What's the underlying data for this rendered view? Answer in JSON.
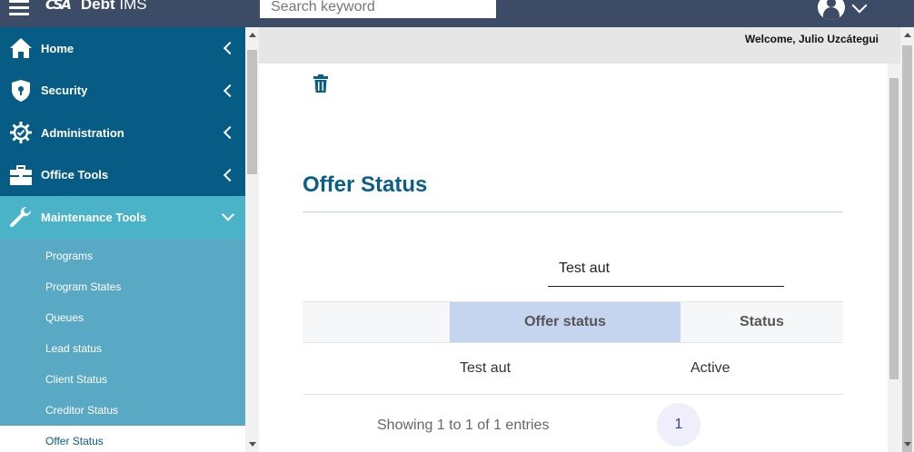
{
  "header": {
    "logo_mark": "CSA",
    "app_name_bold": "Debt",
    "app_name_rest": " IMS",
    "search_placeholder": "Search keyword",
    "icons": [
      "hamburger-icon",
      "user-avatar-icon",
      "chevron-down-icon"
    ]
  },
  "sidebar": {
    "items": [
      {
        "label": "Home",
        "icon": "home-icon"
      },
      {
        "label": "Security",
        "icon": "shield-icon"
      },
      {
        "label": "Administration",
        "icon": "gear-icon"
      },
      {
        "label": "Office Tools",
        "icon": "briefcase-icon"
      },
      {
        "label": "Maintenance Tools",
        "icon": "wrench-icon",
        "expanded": true
      }
    ],
    "sub_items": [
      {
        "label": "Programs"
      },
      {
        "label": "Program States"
      },
      {
        "label": "Queues"
      },
      {
        "label": "Lead status"
      },
      {
        "label": "Client Status"
      },
      {
        "label": "Creditor Status"
      },
      {
        "label": "Offer Status",
        "active": true
      }
    ]
  },
  "main": {
    "welcome": "Welcome, Julio Uzcátegui",
    "page_title": "Offer Status",
    "filter_value": "Test aut",
    "table": {
      "columns": [
        "",
        "Offer status",
        "Status"
      ],
      "rows": [
        {
          "offer_status": "Test aut",
          "status": "Active"
        }
      ]
    },
    "showing": "Showing 1 to 1 of 1 entries",
    "current_page": "1"
  },
  "colors": {
    "topbar": "#3d4c66",
    "nav_dark": "#075c86",
    "nav_open": "#4ab3c7",
    "sub_bg": "#5aa9c4",
    "title": "#0b5f86",
    "highlight_col": "#c5d5ef"
  }
}
